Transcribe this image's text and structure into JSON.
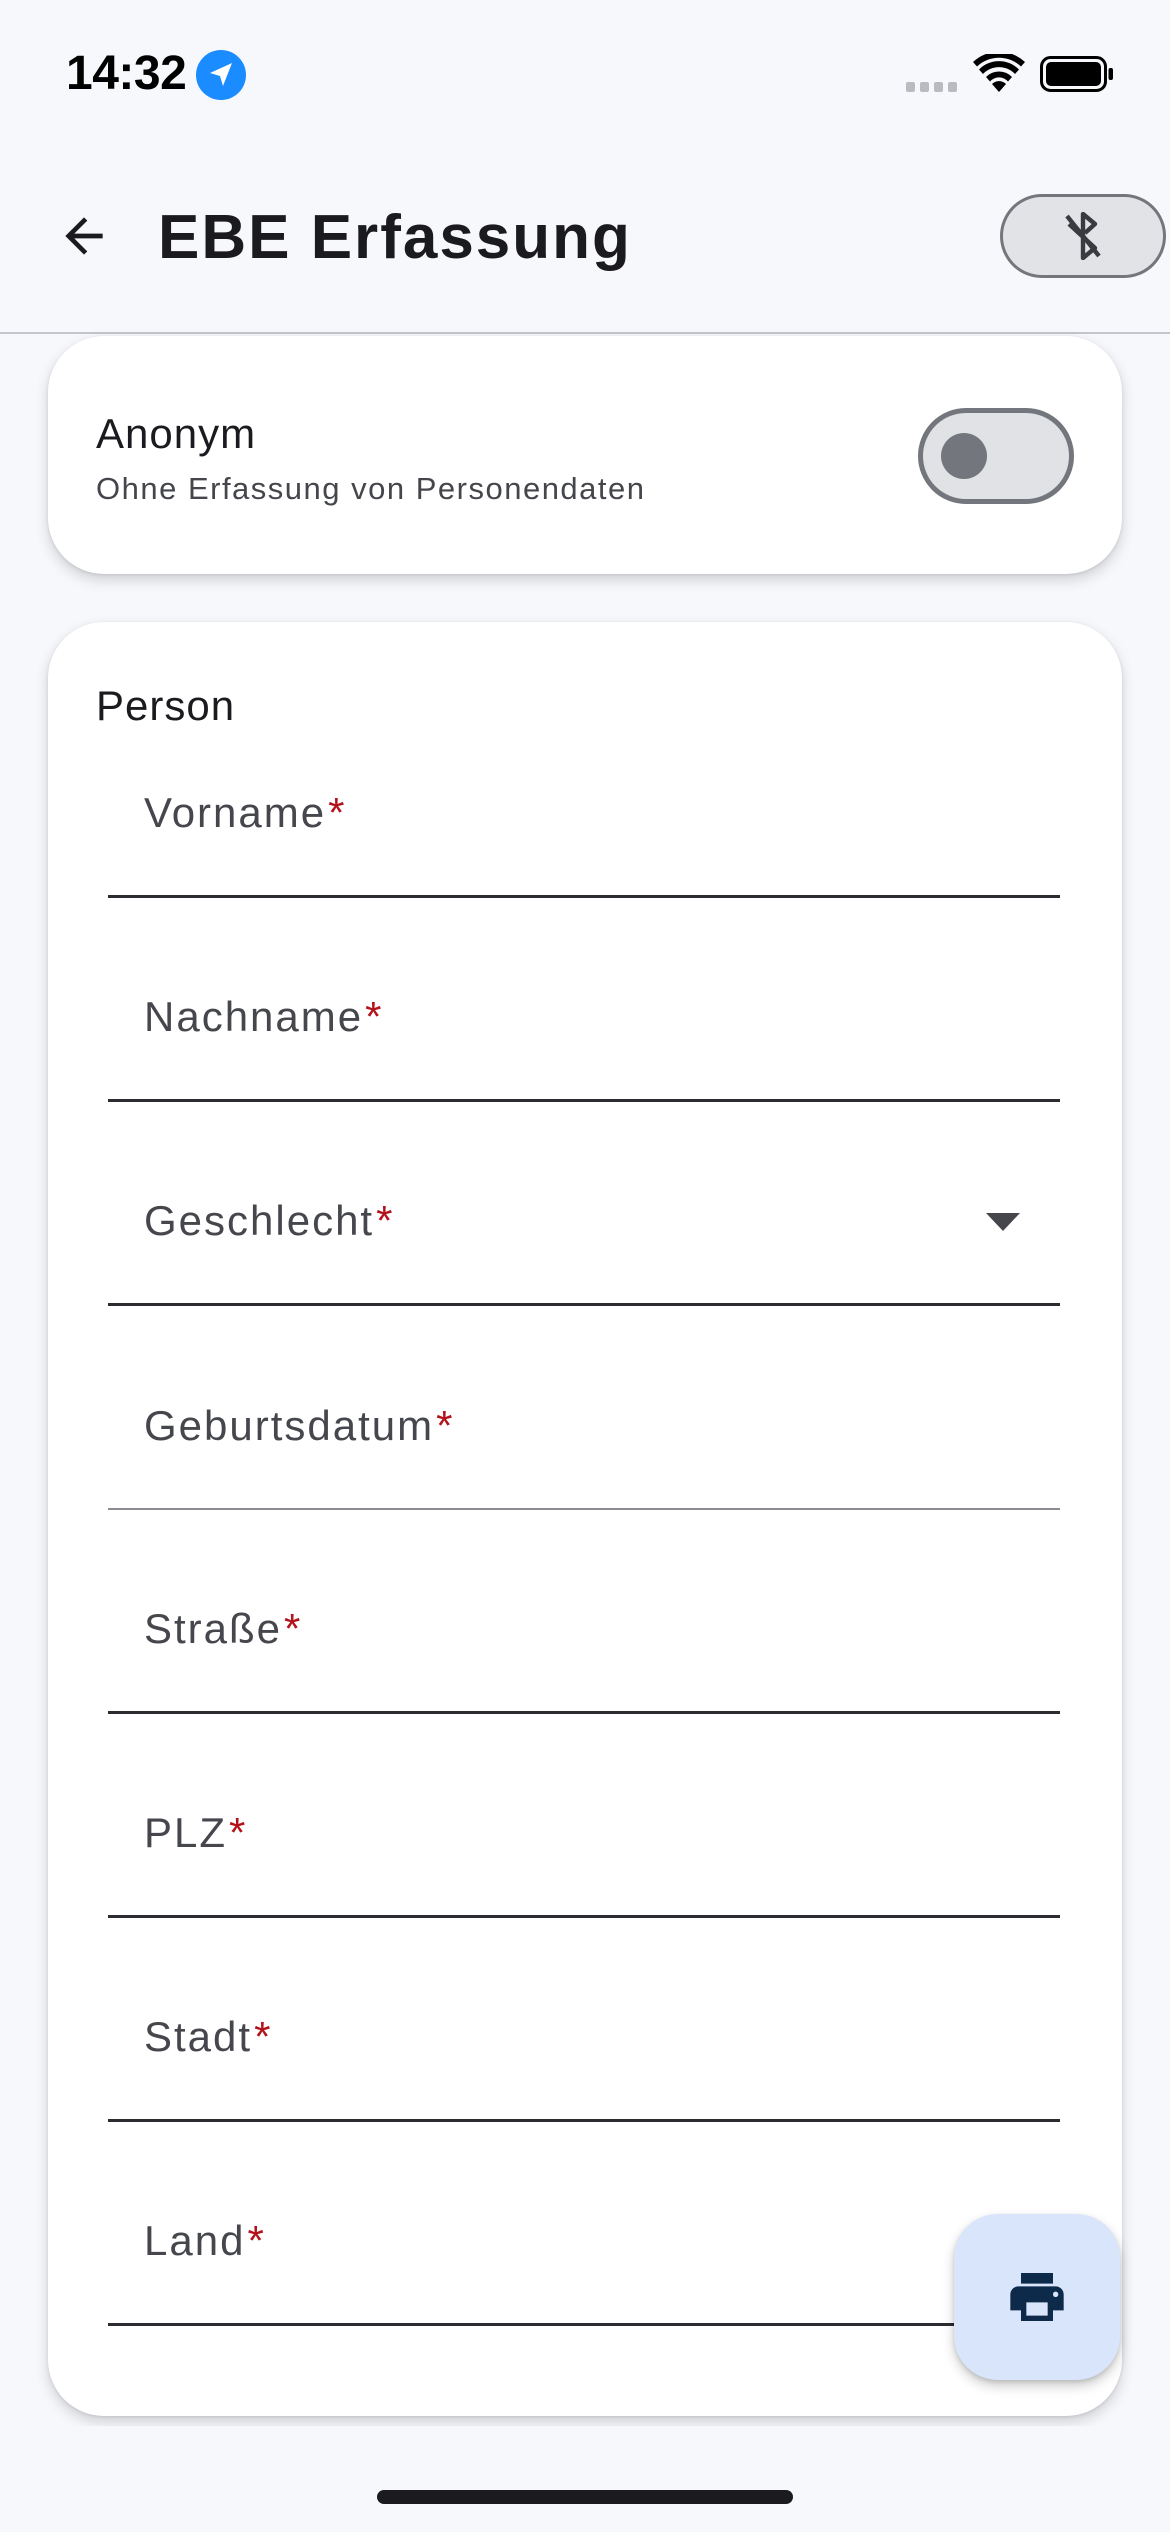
{
  "status_bar": {
    "time": "14:32",
    "icons": [
      "location-arrow-icon",
      "cellular-signal-icon",
      "wifi-icon",
      "battery-icon"
    ]
  },
  "app_bar": {
    "title": "EBE Erfassung",
    "back_icon": "arrow-left-icon",
    "action_icon": "bluetooth-disabled-icon"
  },
  "anonym_card": {
    "title": "Anonym",
    "subtitle": "Ohne Erfassung von Personendaten",
    "toggle_on": false
  },
  "person_card": {
    "title": "Person",
    "fields": [
      {
        "label": "Vorname",
        "required_mark": "*"
      },
      {
        "label": "Nachname",
        "required_mark": "*"
      },
      {
        "label": "Geschlecht",
        "required_mark": "*",
        "type": "dropdown"
      },
      {
        "label": "Geburtsdatum",
        "required_mark": "*"
      },
      {
        "label": "Straße",
        "required_mark": "*"
      },
      {
        "label": "PLZ",
        "required_mark": "*"
      },
      {
        "label": "Stadt",
        "required_mark": "*"
      },
      {
        "label": "Land",
        "required_mark": "*"
      }
    ]
  },
  "fab": {
    "icon": "print-icon"
  },
  "colors": {
    "background": "#f6f8fc",
    "required": "#b3121b",
    "fab_background": "#d9e5fb",
    "fab_icon": "#0e2a4a",
    "location_blue": "#1a8cff"
  }
}
